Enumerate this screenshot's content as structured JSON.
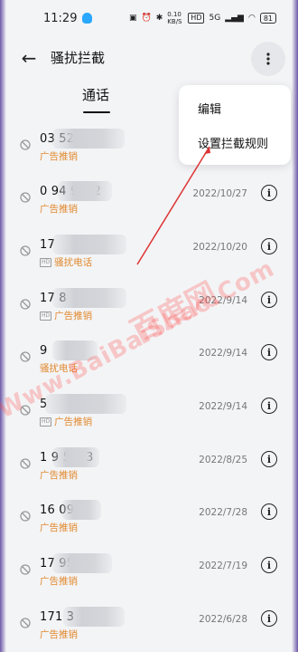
{
  "status": {
    "time": "11:29",
    "net_speed": "0.10 KB/S",
    "hd": "HD",
    "signal": "5G",
    "battery": "81"
  },
  "header": {
    "title": "骚扰拦截"
  },
  "tabs": {
    "active": "通话"
  },
  "menu": {
    "items": [
      "编辑",
      "设置拦截规则"
    ]
  },
  "calls": [
    {
      "number": "03           5276",
      "tag": "广告推销",
      "date": "",
      "sim": false
    },
    {
      "number": "0            94 9232",
      "tag": "广告推销",
      "date": "2022/10/27",
      "sim": false
    },
    {
      "number": "17",
      "tag": "骚扰电话",
      "date": "2022/10/20",
      "sim": true
    },
    {
      "number": "17           8",
      "tag": "广告推销",
      "date": "2022/9/14",
      "sim": true
    },
    {
      "number": "9",
      "tag": "骚扰电话",
      "date": "2022/9/14",
      "sim": false
    },
    {
      "number": "             5",
      "tag": "广告推销",
      "date": "2022/9/14",
      "sim": true
    },
    {
      "number": "1            9 5963",
      "tag": "广告推销",
      "date": "2022/8/25",
      "sim": false
    },
    {
      "number": "16           0942",
      "tag": "广告推销",
      "date": "2022/7/28",
      "sim": false
    },
    {
      "number": "17           95",
      "tag": "广告推销",
      "date": "2022/7/19",
      "sim": false
    },
    {
      "number": "171          3",
      "tag": "广告推销",
      "date": "2022/6/28",
      "sim": false
    }
  ],
  "watermark": {
    "url": "Www.BaiBaiShao.Com",
    "cn": "百度网"
  }
}
